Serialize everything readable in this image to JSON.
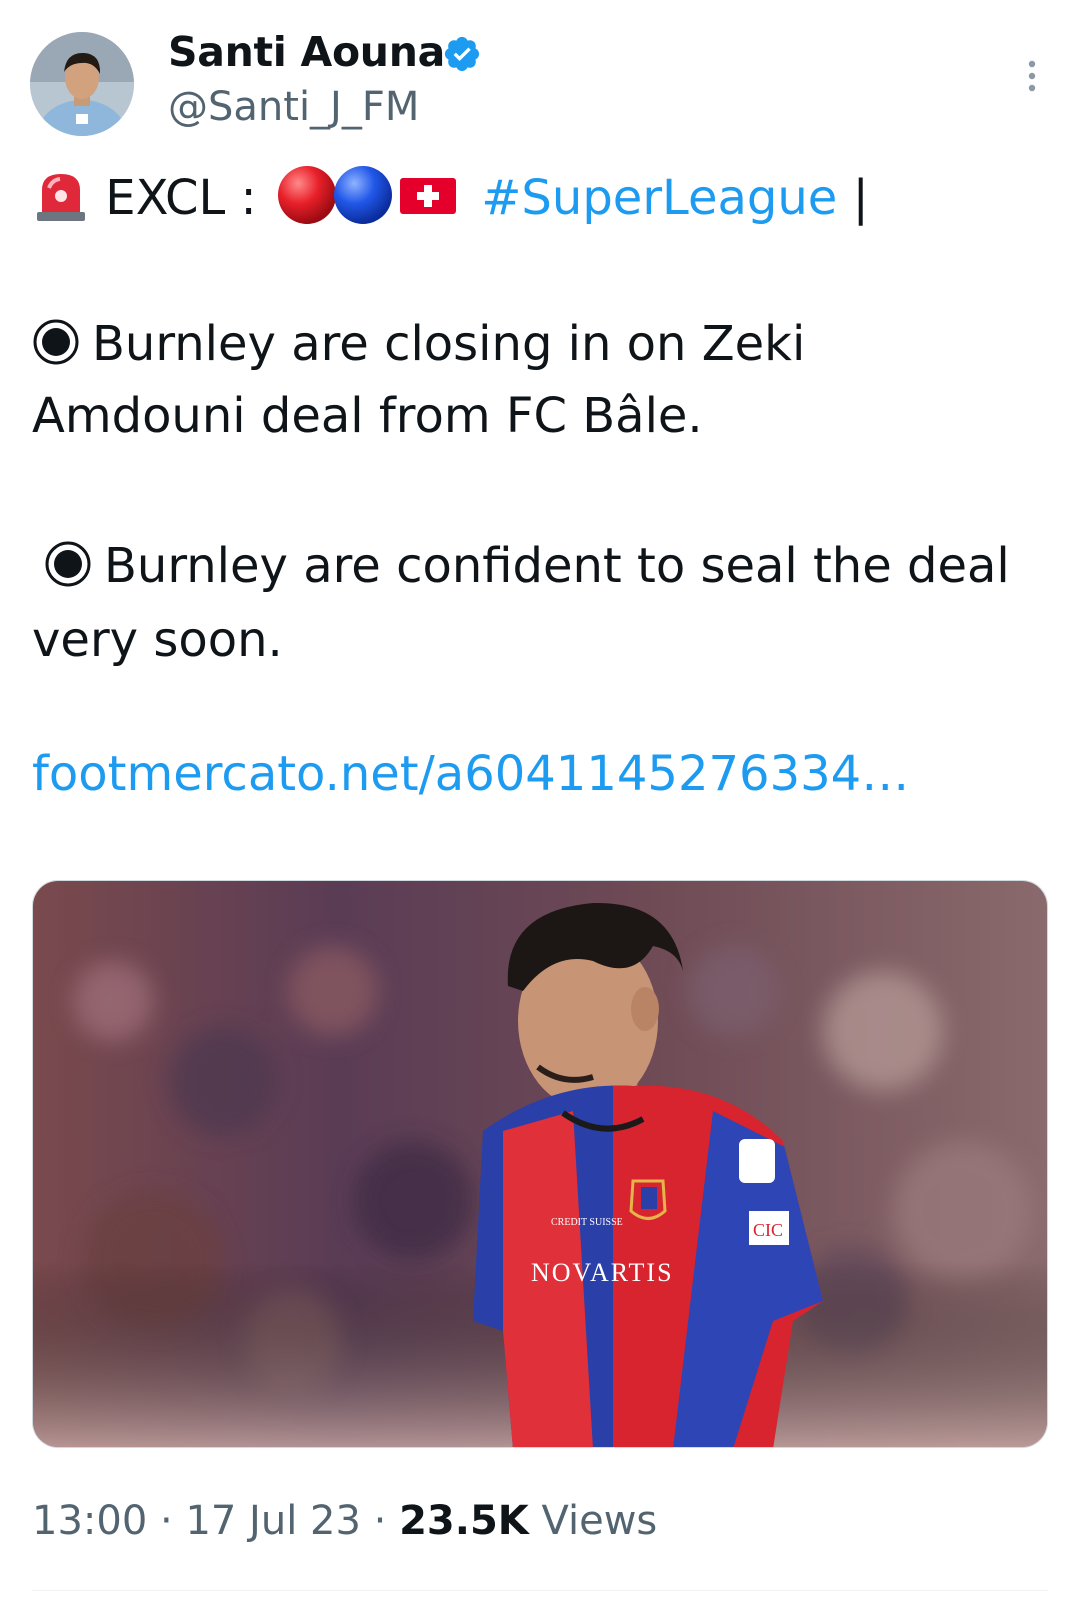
{
  "author": {
    "display_name": "Santi Aouna",
    "handle": "@Santi_J_FM",
    "verified": true
  },
  "tweet": {
    "line1_prefix": "EXCL :",
    "hashtag": "#SuperLeague",
    "line1_suffix": "|",
    "bullet1_line1": "Burnley are closing in on Zeki",
    "bullet1_line2": "Amdouni deal from FC Bâle.",
    "bullet2_line1": "Burnley are confident to seal the deal",
    "bullet2_line2": "very soon.",
    "link": "footmercato.net/a6041145276334…"
  },
  "media": {
    "jersey_sponsor": "NOVARTIS",
    "jersey_sponsor_2": "CREDIT SUISSE",
    "sleeve_sponsor": "CIC"
  },
  "meta": {
    "time": "13:00",
    "date": "17 Jul 23",
    "views_count": "23.5K",
    "views_label": "Views"
  },
  "colors": {
    "accent": "#1d9bf0",
    "secondary_text": "#536471",
    "primary_text": "#0f1419"
  },
  "icons": [
    "verified-badge-icon",
    "more-options-icon",
    "siren-emoji",
    "red-circle-emoji",
    "blue-circle-emoji",
    "swiss-flag-emoji",
    "radio-bullet-icon"
  ]
}
